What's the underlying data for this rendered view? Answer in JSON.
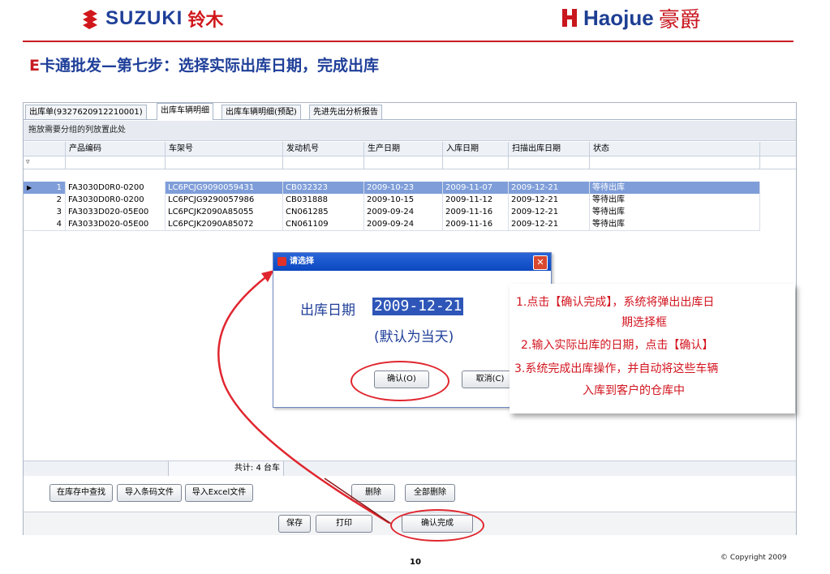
{
  "header": {
    "suzuki_logo": "SUZUKI",
    "suzuki_cn": "铃木",
    "haojue_logo": "Haojue",
    "haojue_cn": "豪爵"
  },
  "slide": {
    "title_prefix": "E",
    "title_rest": "卡通批发—第七步：选择实际出库日期，完成出库"
  },
  "tabs": [
    {
      "label": "出库单(9327620912210001)"
    },
    {
      "label": "出库车辆明细"
    },
    {
      "label": "出库车辆明细(预配)"
    },
    {
      "label": "先进先出分析报告"
    }
  ],
  "grid": {
    "group_hint": "拖放需要分组的列放置此处",
    "columns": [
      "产品编码",
      "车架号",
      "发动机号",
      "生产日期",
      "入库日期",
      "扫描出库日期",
      "状态"
    ],
    "rows": [
      {
        "no": "1",
        "code": "FA3030D0R0-0200",
        "frame": "LC6PCJG9090059431",
        "engine": "CB032323",
        "prod": "2009-10-23",
        "in": "2009-11-07",
        "scan": "2009-12-21",
        "status": "等待出库",
        "selected": true
      },
      {
        "no": "2",
        "code": "FA3030D0R0-0200",
        "frame": "LC6PCJG9290057986",
        "engine": "CB031888",
        "prod": "2009-10-15",
        "in": "2009-11-12",
        "scan": "2009-12-21",
        "status": "等待出库",
        "selected": false
      },
      {
        "no": "3",
        "code": "FA3033D020-05E00",
        "frame": "LC6PCJK2090A85055",
        "engine": "CN061285",
        "prod": "2009-09-24",
        "in": "2009-11-16",
        "scan": "2009-12-21",
        "status": "等待出库",
        "selected": false
      },
      {
        "no": "4",
        "code": "FA3033D020-05E00",
        "frame": "LC6PCJK2090A85072",
        "engine": "CN061109",
        "prod": "2009-09-24",
        "in": "2009-11-16",
        "scan": "2009-12-21",
        "status": "等待出库",
        "selected": false
      }
    ],
    "total": "共计: 4 台车"
  },
  "toolbar": {
    "find_in_stock": "在库存中查找",
    "import_barcode": "导入条码文件",
    "import_excel": "导入Excel文件",
    "delete": "删除",
    "delete_all": "全部删除",
    "save": "保存",
    "print": "打印",
    "confirm_complete": "确认完成"
  },
  "dialog": {
    "title": "请选择",
    "date_label": "出库日期",
    "date_value": "2009-12-21",
    "date_hint": "(默认为当天)",
    "confirm": "确认(O)",
    "cancel": "取消(C)"
  },
  "callout": {
    "line1": "1.点击【确认完成】，系统将弹出出库日",
    "line2": "期选择框",
    "line3": "2.输入实际出库的日期，点击【确认】",
    "line4": "3.系统完成出库操作，并自动将这些车辆",
    "line5": "入库到客户的仓库中"
  },
  "footer": {
    "page_number": "10",
    "copyright": "© Copyright  2009"
  },
  "colors": {
    "brand_blue": "#1f3f99",
    "brand_red": "#c81c23",
    "selection": "#7f9ed9",
    "annotation_red": "#e0262f"
  }
}
